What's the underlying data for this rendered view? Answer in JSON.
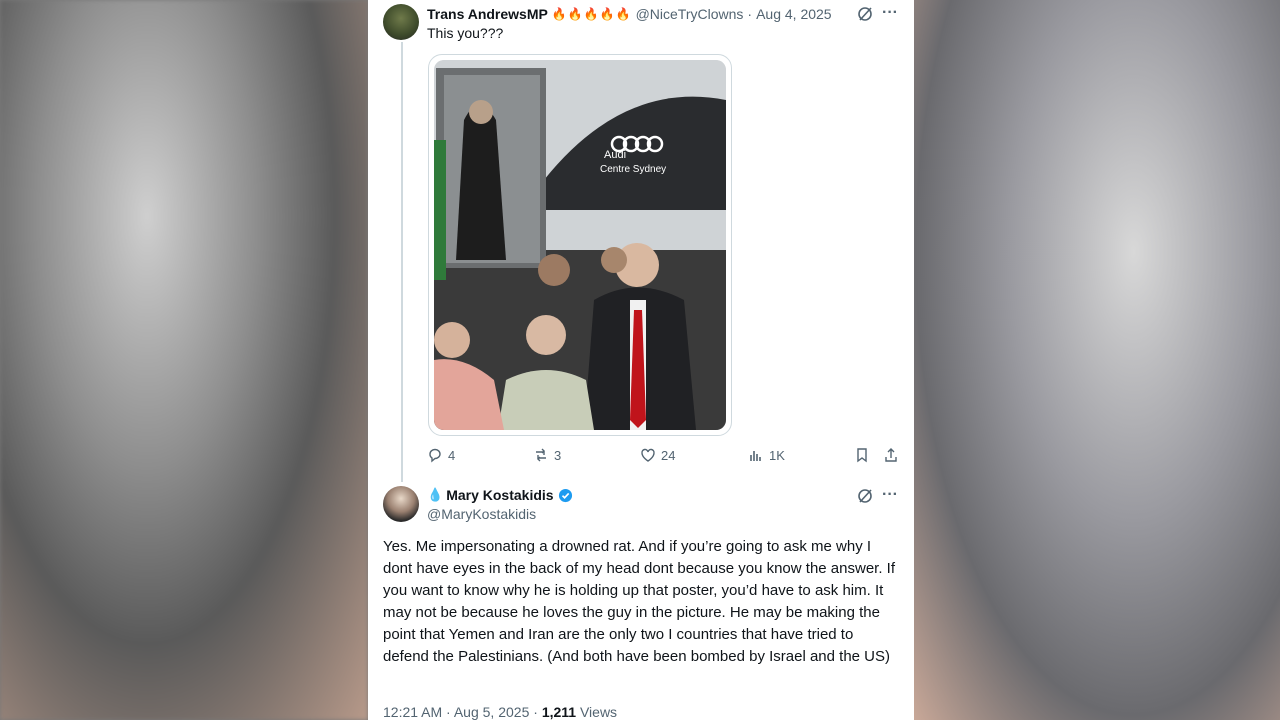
{
  "tweet": {
    "display_name": "Trans AndrewsMP",
    "name_emojis": "🔥🔥🔥🔥🔥",
    "handle": "@NiceTryClowns",
    "separator": "·",
    "date": "Aug 4, 2025",
    "text": "This you???",
    "image_text": {
      "brand": "Audi",
      "dealer": "Centre Sydney"
    },
    "stats": {
      "replies": "4",
      "reposts": "3",
      "likes": "24",
      "views": "1K"
    }
  },
  "reply": {
    "name_prefix": "💧",
    "display_name": "Mary Kostakidis",
    "handle": "@MaryKostakidis",
    "text": "Yes. Me impersonating a drowned rat. And if you’re going to ask me why I dont have eyes in the back of my head dont because you know the answer. If you want to know why he is holding up that poster, you’d have to ask him. It may not be because he loves the guy in the picture. He may be making the point that Yemen and Iran are the only two I countries that have tried to defend the Palestinians. (And both have been bombed by Israel and the US)",
    "time": "12:21 AM",
    "separator": "·",
    "date": "Aug 5, 2025",
    "views_count": "1,211",
    "views_label": "Views"
  },
  "colors": {
    "verified": "#1d9bf0",
    "muted": "#536471",
    "text": "#0f1419"
  }
}
